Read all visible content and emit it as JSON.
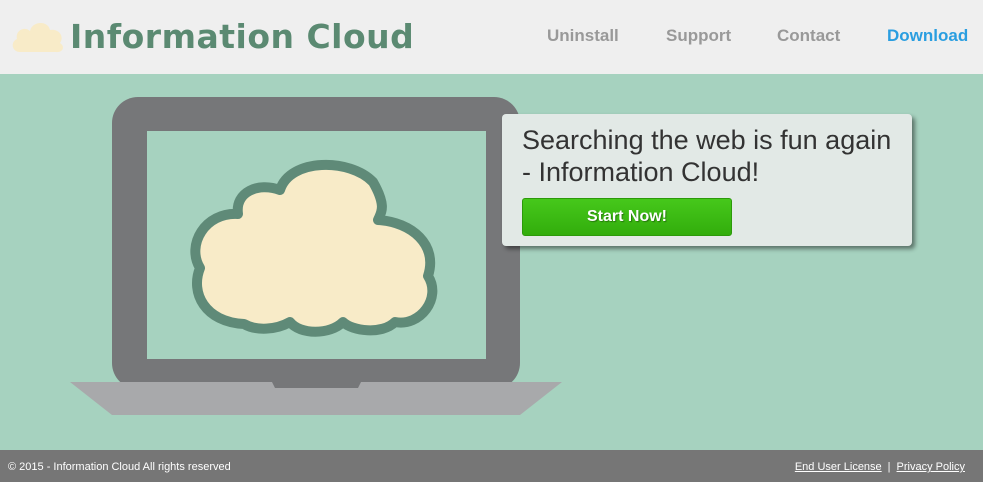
{
  "brand": {
    "name": "Information Cloud",
    "logo_icon": "cloud-icon"
  },
  "nav": {
    "items": [
      {
        "label": "Uninstall"
      },
      {
        "label": "Support"
      },
      {
        "label": "Contact"
      },
      {
        "label": "Download"
      }
    ]
  },
  "hero": {
    "headline": "Searching the web is fun again - Information Cloud!",
    "cta_label": "Start Now!",
    "illustration_icons": [
      "laptop-icon",
      "cloud-icon"
    ]
  },
  "footer": {
    "copyright": "© 2015 - Information Cloud All rights reserved",
    "links": [
      {
        "label": "End User License"
      },
      {
        "label": "Privacy Policy"
      }
    ],
    "separator": "|"
  },
  "colors": {
    "page_background": "#a6d2bf",
    "header_background": "#efefef",
    "brand_text": "#5b8a72",
    "nav_text": "#999999",
    "nav_active": "#2a9ee0",
    "cta_button": "#3dba14",
    "laptop_body": "#767779",
    "laptop_base": "#a8a9ab",
    "cloud_fill": "#f8ebc8",
    "cloud_outline": "#5f8a78",
    "footer_background": "#767676"
  }
}
